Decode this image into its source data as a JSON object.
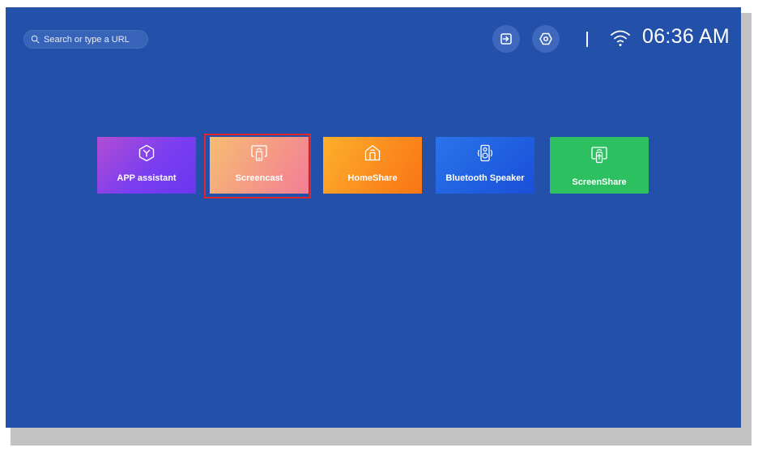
{
  "search": {
    "placeholder": "Search or type a URL"
  },
  "status": {
    "time": "06:36 AM"
  },
  "header_icons": [
    "input-source-icon",
    "settings-icon",
    "wifi-icon"
  ],
  "tiles": [
    {
      "label": "APP assistant",
      "icon": "hexagon-y-icon",
      "focused": false
    },
    {
      "label": "Screencast",
      "icon": "screencast-icon",
      "focused": true
    },
    {
      "label": "HomeShare",
      "icon": "home-share-icon",
      "focused": false
    },
    {
      "label": "Bluetooth Speaker",
      "icon": "speaker-icon",
      "focused": false
    },
    {
      "label": "ScreenShare",
      "icon": "screen-share-icon",
      "focused": false
    }
  ],
  "colors": {
    "background": "#2350a8",
    "focus_ring": "#e0262d",
    "app_tile": "#7a3ef0",
    "screencast_tile": "#f49986",
    "homeshare_tile": "#fb8a1e",
    "bluetooth_tile": "#1f5ee0",
    "screenshare_tile": "#2cc061"
  }
}
